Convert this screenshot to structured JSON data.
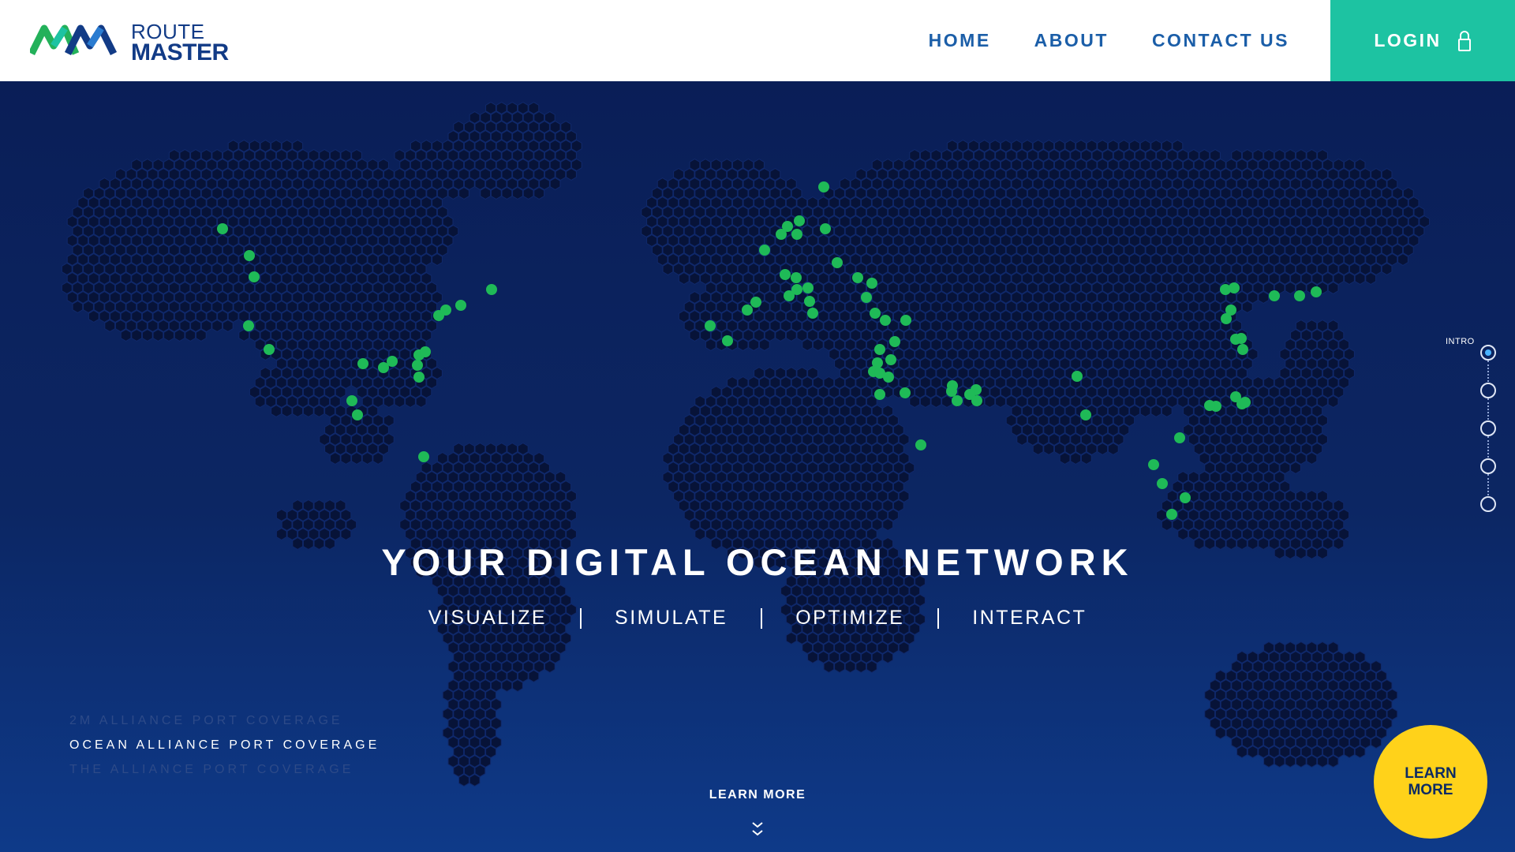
{
  "brand": {
    "line1": "ROUTE",
    "line2": "MASTER"
  },
  "nav": {
    "home": "HOME",
    "about": "ABOUT",
    "contact": "CONTACT US"
  },
  "login": {
    "label": "LOGIN",
    "icon": "lock-icon"
  },
  "hero": {
    "headline": "YOUR DIGITAL OCEAN NETWORK",
    "features": [
      "VISUALIZE",
      "SIMULATE",
      "OPTIMIZE",
      "INTERACT"
    ]
  },
  "coverage": {
    "options": [
      "2M ALLIANCE PORT  COVERAGE",
      "OCEAN ALLIANCE PORT  COVERAGE",
      "THE ALLIANCE PORT  COVERAGE"
    ],
    "selected": "OCEAN ALLIANCE PORT  COVERAGE"
  },
  "learn_more": {
    "center_label": "LEARN MORE",
    "bubble_line1": "LEARN",
    "bubble_line2": "MORE"
  },
  "side_nav": {
    "label": "INTRO",
    "count": 5,
    "active_index": 0
  },
  "colors": {
    "header_bg": "#ffffff",
    "nav_text": "#1b5ea8",
    "login_bg": "#1dc3a2",
    "hero_bg": "#0b1f5c",
    "hex_fill": "#071338",
    "port_green": "#1fba57",
    "learn_bubble": "#ffd21a"
  }
}
